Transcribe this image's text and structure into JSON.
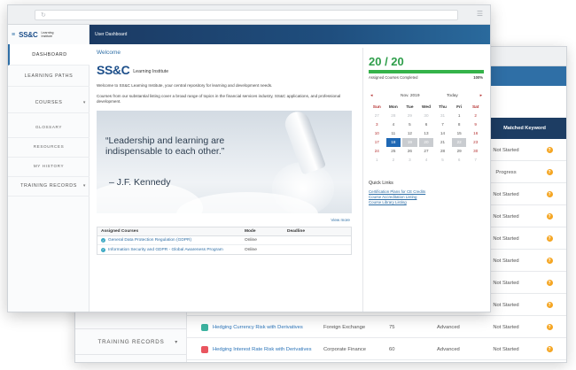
{
  "back": {
    "table_headers": [
      "Matched Keyword"
    ],
    "rows": [
      {
        "status": "Not Started"
      },
      {
        "status": "Progress"
      },
      {
        "status": "Not Started"
      },
      {
        "status": "Not Started"
      },
      {
        "status": "Not Started"
      },
      {
        "status": "Not Started"
      },
      {
        "status": "Not Started"
      },
      {
        "status": "Not Started"
      },
      {
        "course": "Hedging Currency Risk with Derivatives",
        "topic": "Foreign Exchange",
        "mins": "75",
        "level": "Advanced",
        "status": "Not Started"
      },
      {
        "course": "Hedging Interest Rate Risk with Derivatives",
        "topic": "Corporate Finance",
        "mins": "60",
        "level": "Advanced",
        "status": "Not Started"
      }
    ],
    "keyword_icon": "question-icon",
    "sidebar_item": "TRAINING RECORDS"
  },
  "front": {
    "logo": {
      "mark": "SS&C",
      "sub": "Learning Institute"
    },
    "topbar_title": "User Dashboard",
    "nav": [
      {
        "label": "DASHBOARD",
        "active": true
      },
      {
        "label": "LEARNING PATHS"
      },
      {
        "label": "COURSES",
        "chevron": "▾"
      },
      {
        "label": "GLOSSARY",
        "sub": true
      },
      {
        "label": "RESOURCES",
        "sub": true
      },
      {
        "label": "MY HISTORY",
        "sub": true
      },
      {
        "label": "TRAINING RECORDS",
        "chevron": "▾"
      }
    ],
    "welcome": "Welcome",
    "brand": {
      "mark": "SS&C",
      "text": "Learning Institute"
    },
    "intro1": "Welcome to SS&C Learning Institute, your central repository for learning and development needs.",
    "intro2": "Courses from our substantial listing cover a broad range of topics in the financial services industry, SS&C applications, and professional development.",
    "quote": "“Leadership and learning are indispensable to each other.”",
    "attribution": "– J.F. Kennedy",
    "view_more": "View more",
    "assigned": {
      "headers": [
        "Assigned Courses",
        "Mode",
        "Deadline"
      ],
      "rows": [
        {
          "name": "General Data Protection Regulation (GDPR)",
          "mode": "Online",
          "deadline": ""
        },
        {
          "name": "Information Security and GDPR - Global Awareness Program",
          "mode": "Online",
          "deadline": ""
        }
      ]
    },
    "progress": {
      "score": "20 / 20",
      "label": "Assigned Courses Completed",
      "percent_text": "100%",
      "fraction": 1.0
    },
    "calendar": {
      "prev": "◂",
      "month": "Nov. 2019",
      "today": "Today",
      "next": "▸",
      "dow": [
        "Sun",
        "Mon",
        "Tue",
        "Wed",
        "Thu",
        "Fri",
        "Sat"
      ],
      "weeks": [
        [
          "27",
          "28",
          "29",
          "30",
          "31",
          "1",
          "2"
        ],
        [
          "3",
          "4",
          "5",
          "6",
          "7",
          "8",
          "9"
        ],
        [
          "10",
          "11",
          "12",
          "13",
          "14",
          "15",
          "16"
        ],
        [
          "17",
          "18",
          "19",
          "20",
          "21",
          "22",
          "23"
        ],
        [
          "24",
          "25",
          "26",
          "27",
          "28",
          "29",
          "30"
        ],
        [
          "1",
          "2",
          "3",
          "4",
          "5",
          "6",
          "7"
        ]
      ],
      "selected": "18"
    },
    "quick_links": {
      "title": "Quick Links",
      "items": [
        "Certification Plans for CE Credits",
        "Course Accreditation Listing",
        "Course Library Listing"
      ]
    }
  }
}
